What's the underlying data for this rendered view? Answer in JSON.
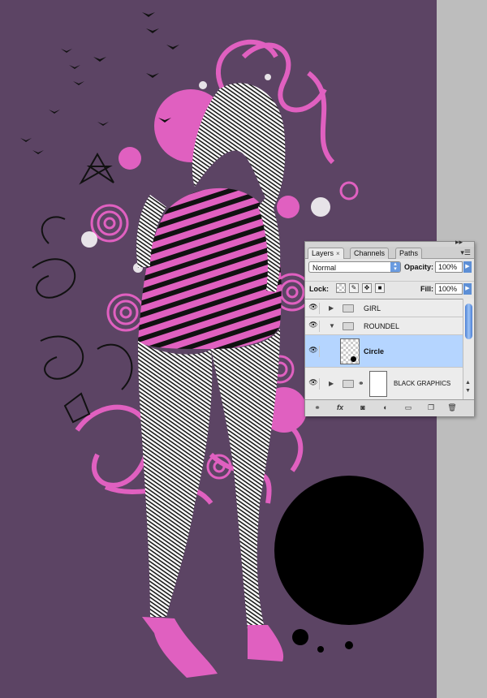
{
  "panel": {
    "tabs": [
      {
        "label": "Layers",
        "close": "×"
      },
      {
        "label": "Channels"
      },
      {
        "label": "Paths"
      }
    ],
    "blend_mode": "Normal",
    "opacity_label": "Opacity:",
    "opacity_value": "100%",
    "lock_label": "Lock:",
    "fill_label": "Fill:",
    "fill_value": "100%",
    "layers": [
      {
        "name": "GIRL",
        "type": "group",
        "expanded": false,
        "visible": true
      },
      {
        "name": "ROUNDEL",
        "type": "group",
        "expanded": true,
        "visible": true
      },
      {
        "name": "Circle",
        "type": "layer",
        "selected": true,
        "visible": true
      },
      {
        "name": "BLACK GRAPHICS",
        "type": "group",
        "expanded": false,
        "visible": true
      }
    ],
    "icons": {
      "eye": "eye-icon",
      "link": "link-icon",
      "fx": "fx",
      "mask": "mask-icon",
      "adjustment": "adjustment-icon",
      "folder": "new-group-icon",
      "new_layer": "new-layer-icon",
      "trash": "trash-icon"
    }
  },
  "colors": {
    "canvas_bg": "#5c4464",
    "accent_pink": "#e060c0",
    "selection": "#b5d5ff"
  }
}
